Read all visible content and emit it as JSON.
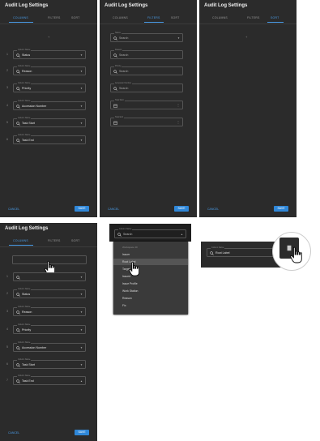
{
  "dialog": {
    "title": "Audit Log Settings",
    "tabs": [
      "COLUMNS",
      "FILTERS",
      "SORT"
    ],
    "cancel_label": "CANCEL",
    "save_label": "SAVE",
    "add_symbol": "+"
  },
  "columns_panel": {
    "field_label": "Column Name",
    "rows": [
      {
        "index": "1",
        "value": "Status"
      },
      {
        "index": "2",
        "value": "Reason"
      },
      {
        "index": "3",
        "value": "Priority"
      },
      {
        "index": "4",
        "value": "Accession Number"
      },
      {
        "index": "5",
        "value": "Task Start"
      },
      {
        "index": "6",
        "value": "Task End"
      }
    ]
  },
  "filters_panel": {
    "filters": [
      {
        "label": "Status",
        "placeholder": "Search",
        "kind": "dropdown"
      },
      {
        "label": "Reason",
        "placeholder": "Search",
        "kind": "search"
      },
      {
        "label": "Priority",
        "placeholder": "Search",
        "kind": "search"
      },
      {
        "label": "Accession Number",
        "placeholder": "Search",
        "kind": "search"
      },
      {
        "label": "Task Start",
        "placeholder": "",
        "kind": "date"
      },
      {
        "label": "Task End",
        "placeholder": "",
        "kind": "date"
      }
    ]
  },
  "sort_panel": {
    "add_symbol": "+"
  },
  "columns_add_panel": {
    "field_label": "Column Name",
    "rows": [
      {
        "index": "1",
        "value": ""
      },
      {
        "index": "2",
        "value": "Status"
      },
      {
        "index": "3",
        "value": "Reason"
      },
      {
        "index": "4",
        "value": "Priority"
      },
      {
        "index": "5",
        "value": "Accession Number"
      },
      {
        "index": "6",
        "value": "Task Start"
      },
      {
        "index": "7",
        "value": "Task End"
      }
    ]
  },
  "dropdown_demo": {
    "field_label": "Column Name",
    "search_value": "Search",
    "options": [
      {
        "text": "Workspace ID",
        "header": true
      },
      {
        "text": "Issuer"
      },
      {
        "text": "Root Label",
        "selected": true
      },
      {
        "text": "Target"
      },
      {
        "text": "Issued"
      },
      {
        "text": "Issue Profile"
      },
      {
        "text": "Work Station"
      },
      {
        "text": "Reason"
      },
      {
        "text": "Fix"
      }
    ]
  },
  "zoom_demo": {
    "field_label": "Column Name",
    "search_value": "Root Label"
  },
  "colors": {
    "panel_bg": "#2b2b2b",
    "accent": "#4a9be6",
    "save_bg": "#2f87d8"
  },
  "icons": [
    "search-icon",
    "calendar-icon",
    "chevron-down-icon",
    "more-vert-icon",
    "hand-cursor-icon"
  ]
}
